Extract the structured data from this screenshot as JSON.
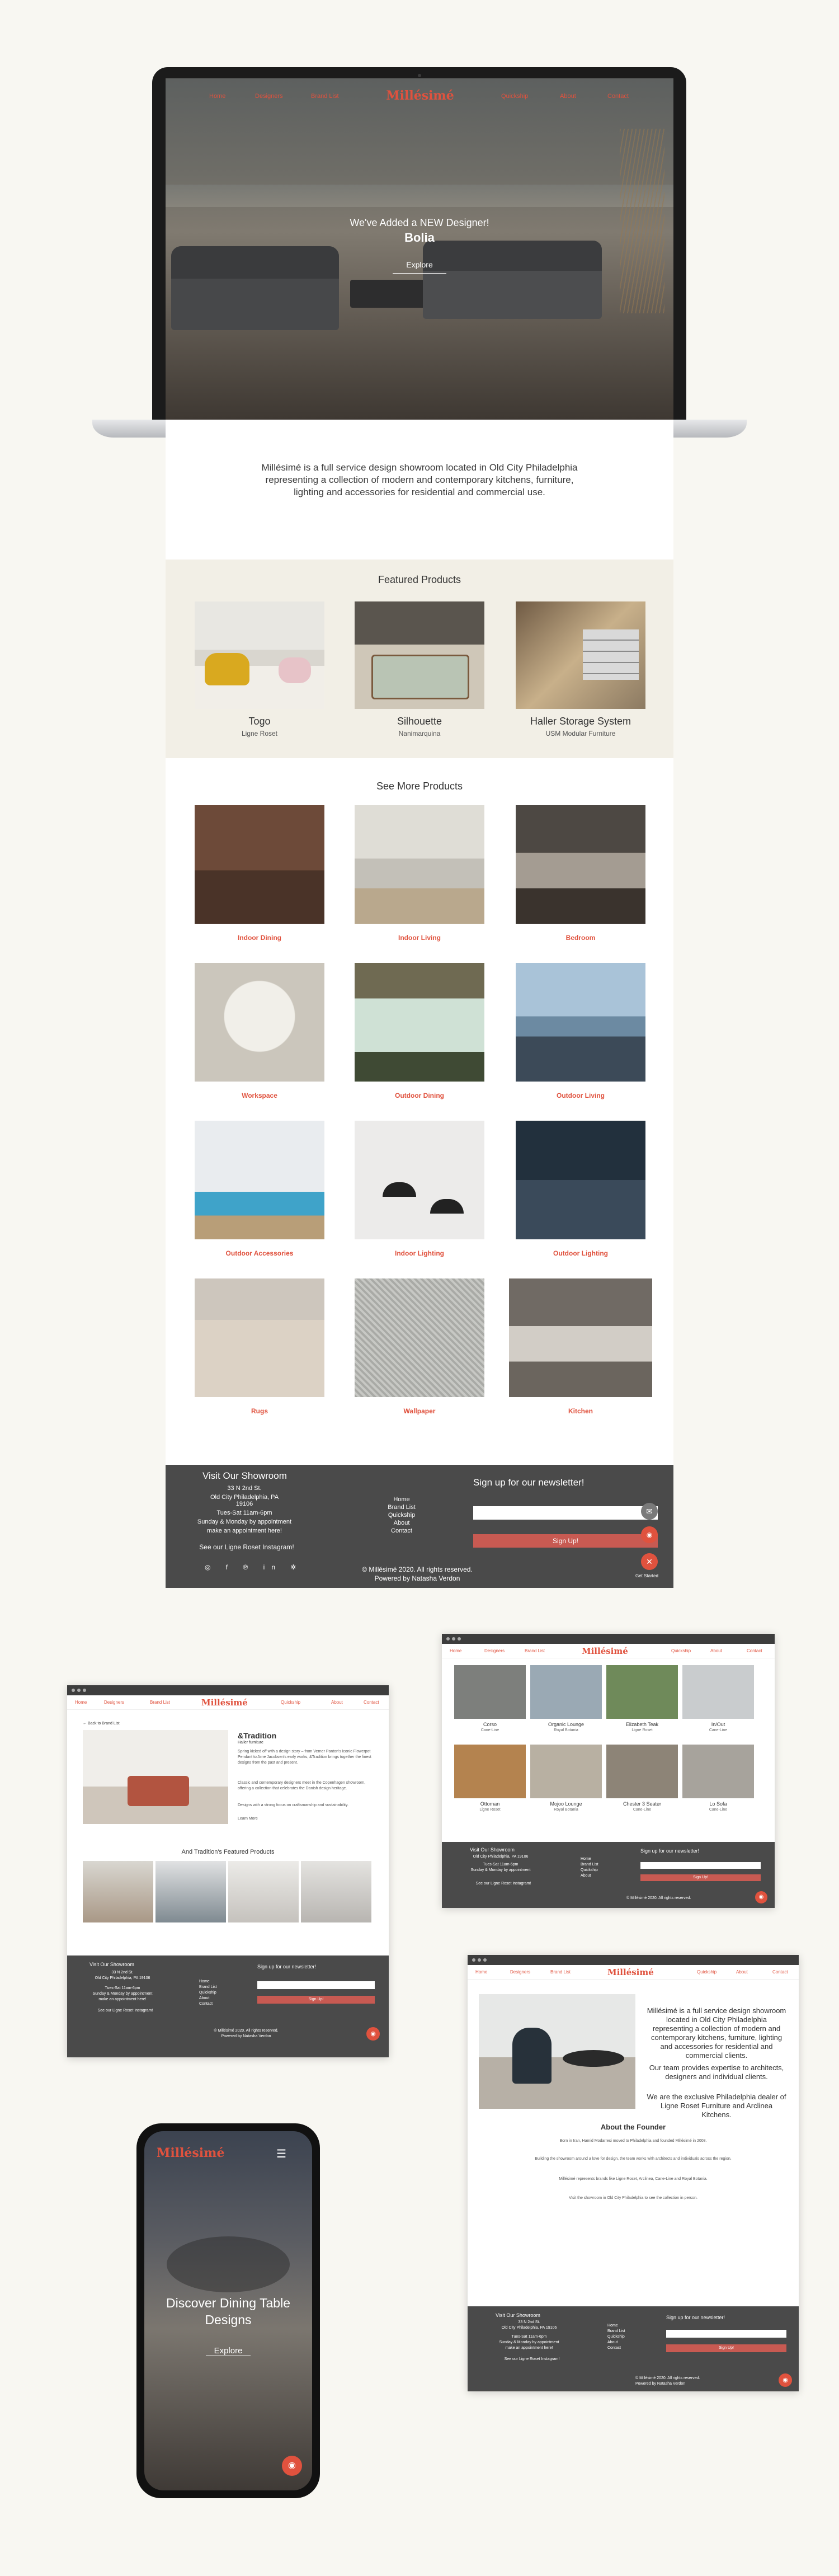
{
  "brand": {
    "logo": "Millésimé",
    "accent": "#e0523e",
    "footer_bg": "#4a4a4a",
    "featured_bg": "#f2efe6"
  },
  "nav": [
    "Home",
    "Designers",
    "Brand List",
    "Quickship",
    "About",
    "Contact"
  ],
  "hero": {
    "kicker": "We've Added a NEW Designer!",
    "title": "Bolia",
    "cta": "Explore"
  },
  "intro": "Millésimé is a full service design showroom located in Old City Philadelphia representing a collection of modern and contemporary kitchens, furniture, lighting and accessories for residential and commercial use.",
  "featured": {
    "title": "Featured Products",
    "items": [
      {
        "name": "Togo",
        "maker": "Ligne Roset"
      },
      {
        "name": "Silhouette",
        "maker": "Nanimarquina"
      },
      {
        "name": "Haller Storage System",
        "maker": "USM Modular Furniture"
      }
    ]
  },
  "more": {
    "title": "See More Products",
    "categories": [
      "Indoor Dining",
      "Indoor Living",
      "Bedroom",
      "Workspace",
      "Outdoor Dining",
      "Outdoor Living",
      "Outdoor Accessories",
      "Indoor Lighting",
      "Outdoor Lighting",
      "Rugs",
      "Wallpaper",
      "Kitchen"
    ]
  },
  "footer": {
    "visit_title": "Visit Our Showroom",
    "address1": "33 N 2nd St.",
    "address2": "Old City Philadelphia, PA 19106",
    "hours1": "Tues-Sat 11am-6pm",
    "hours2": "Sunday & Monday by appointment",
    "hours3": "make an appointment here!",
    "instagram": "See our Ligne Roset Instagram!",
    "links": [
      "Home",
      "Brand List",
      "Quickship",
      "About",
      "Contact"
    ],
    "newsletter_title": "Sign up for our newsletter!",
    "signup_btn": "Sign Up!",
    "copyright": "© Millésimé 2020. All rights reserved.",
    "powered": "Powered by Natasha Verdon",
    "get_started": "Get Started"
  },
  "win_tradition": {
    "back": "← Back to Brand List",
    "title": "&Tradition",
    "subtitle": "Haller furniture",
    "body1": "Spring kicked off with a design story – from Verner Panton's iconic Flowerpot Pendant to Arne Jacobsen's early works, &Tradition brings together the finest designs from the past and present.",
    "body2": "Classic and contemporary designers meet in the Copenhagen showroom, offering a collection that celebrates the Danish design heritage.",
    "body3": "Designs with a strong focus on craftsmanship and sustainability.",
    "more": "Learn More",
    "featured_title": "And Tradition's Featured Products"
  },
  "win_products": {
    "items": [
      {
        "name": "Corso",
        "maker": "Cane-Line"
      },
      {
        "name": "Organic Lounge",
        "maker": "Royal Botania"
      },
      {
        "name": "Elizabeth Teak",
        "maker": "Ligne Roset"
      },
      {
        "name": "In/Out",
        "maker": "Cane-Line"
      },
      {
        "name": "Ottoman",
        "maker": "Ligne Roset"
      },
      {
        "name": "Mojoo Lounge",
        "maker": "Royal Botania"
      },
      {
        "name": "Chester 3 Seater",
        "maker": "Cane-Line"
      },
      {
        "name": "Lo Sofa",
        "maker": "Cane-Line"
      }
    ]
  },
  "win_about": {
    "p1": "Millésimé is a full service design showroom located in Old City Philadelphia representing a collection of modern and contemporary kitchens, furniture, lighting and accessories for residential and commercial clients.",
    "p2": "Our team provides expertise to architects, designers and individual clients.",
    "p3": "We are the exclusive Philadelphia dealer of Ligne Roset Furniture and Arclinea Kitchens.",
    "founder_title": "About the Founder",
    "f1": "Born in Iran, Hamid Modarresi moved to Philadelphia and founded Millésimé in 2008.",
    "f2": "Building the showroom around a love for design, the team works with architects and individuals across the region.",
    "f3": "Millésimé represents brands like Ligne Roset, Arclinea, Cane-Line and Royal Botania.",
    "f4": "Visit the showroom in Old City Philadelphia to see the collection in person."
  },
  "mobile": {
    "title": "Discover Dining Table Designs",
    "cta": "Explore"
  }
}
